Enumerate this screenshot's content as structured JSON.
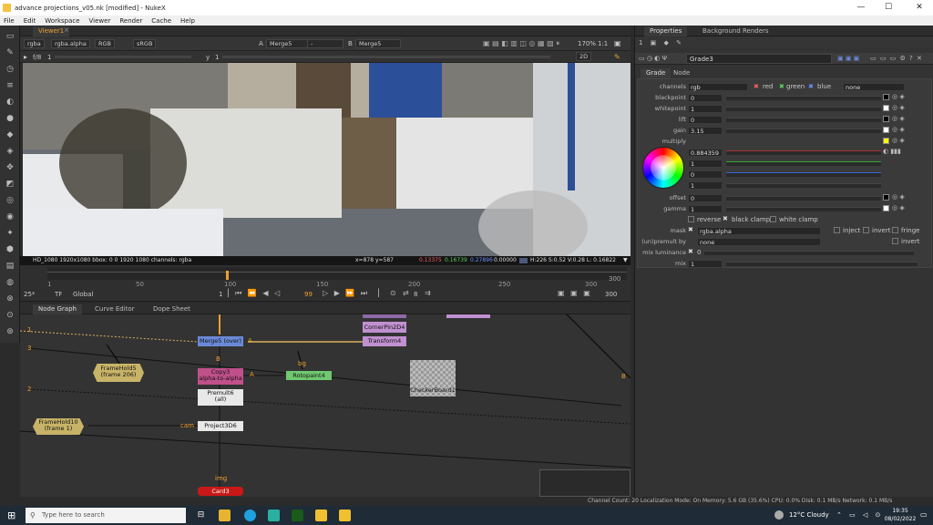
{
  "window": {
    "title": "advance projections_v05.nk [modified] - NukeX",
    "minimize": "—",
    "maximize": "☐",
    "close": "✕"
  },
  "menu": [
    "File",
    "Edit",
    "Workspace",
    "Viewer",
    "Render",
    "Cache",
    "Help"
  ],
  "viewer_tab": {
    "label": "Viewer1"
  },
  "viewer_toolbar": {
    "channels": "rgba",
    "alpha": "rgba.alpha",
    "display": "RGB",
    "colorspace": "sRGB",
    "input_a_label": "A",
    "input_a": "Merge5",
    "wipe": "-",
    "input_b_label": "B",
    "input_b": "Merge5",
    "zoom": "170%",
    "ratio": "1:1",
    "view_mode": "2D"
  },
  "viewer_toolbar2": {
    "fstop": "f/8",
    "gain_value": "1",
    "gamma_label": "y",
    "gamma_value": "1"
  },
  "viewer_info": {
    "format": "HD_1080 1920x1080  bbox: 0 0 1920 1080 channels: rgba",
    "coords": "x=878 y=587",
    "r": "0.13375",
    "g": "0.16739",
    "b": "0.27896",
    "a": "0.00000",
    "hsvl": "H:226 S:0.52 V:0.28  L: 0.16822"
  },
  "timeline": {
    "ticks": [
      "1",
      "50",
      "100",
      "150",
      "200",
      "250",
      "300"
    ],
    "current_frame": "99",
    "end_frame": "300",
    "start_frame": "1",
    "fps": "25*",
    "tf": "TF",
    "global": "Global",
    "step": "8",
    "in_right": "300",
    "out_right": "300"
  },
  "node_tabs": [
    "Node Graph",
    "Curve Editor",
    "Dope Sheet"
  ],
  "nodes": {
    "cornerpin": "CornerPin2D4",
    "transform": "Transform4",
    "merge": "Merge5 (over)",
    "framehold5": "FrameHold5\n(frame 206)",
    "copy": "Copy3\nalpha-to-alpha",
    "roto": "Rotopaint4",
    "checker": "CheckerBoard1",
    "premult": "Premult6\n(all)",
    "framehold10": "FrameHold10\n(frame 1)",
    "project": "Project3D6",
    "card": "Card3",
    "label_b": "B",
    "label_a": "A",
    "label_bg": "bg",
    "label_cam": "cam",
    "label_img": "img",
    "label_1": "1",
    "label_2": "2",
    "label_3": "3",
    "label_b_right": "B"
  },
  "properties": {
    "tabs": [
      "Properties",
      "Background Renders"
    ],
    "node_name": "Grade3",
    "subtabs": [
      "Grade",
      "Node"
    ],
    "channels_label": "channels",
    "channels_value": "rgb",
    "ch_red": "red",
    "ch_green": "green",
    "ch_blue": "blue",
    "ch_none": "none",
    "rows": [
      {
        "label": "blackpoint",
        "value": "0"
      },
      {
        "label": "whitepoint",
        "value": "1"
      },
      {
        "label": "lift",
        "value": "0"
      },
      {
        "label": "gain",
        "value": "3.15"
      },
      {
        "label": "multiply",
        "value": ""
      }
    ],
    "multiply_values": [
      "0.884359",
      "1",
      "0",
      "1"
    ],
    "rows2": [
      {
        "label": "offset",
        "value": "0"
      },
      {
        "label": "gamma",
        "value": "1"
      }
    ],
    "reverse": "reverse",
    "black_clamp": "black clamp",
    "white_clamp": "white clamp",
    "mask_label": "mask",
    "mask_value": "rgba.alpha",
    "inject": "inject",
    "invert": "invert",
    "fringe": "fringe",
    "unpremult_label": "(un)premult by",
    "unpremult_value": "none",
    "invert2": "invert",
    "mix_lum_label": "mix luminance",
    "mix_lum_value": "0",
    "mix_label": "mix",
    "mix_value": "1",
    "slider_ticks": [
      "0",
      "0.1",
      "0.2",
      "0.3",
      "0.4",
      "0.5",
      "0.6",
      "0.7",
      "0.8",
      "0.9",
      "1"
    ]
  },
  "status": {
    "text": "Channel Count: 20  Localization Mode: On  Memory: 5.6 GB (35.6%)  CPU: 0.0%  Disk: 0.1 MB/s  Network: 0.1 MB/s"
  },
  "taskbar": {
    "search": "Type here to search",
    "weather": "12°C  Cloudy",
    "time": "19:35",
    "date": "08/02/2022"
  }
}
